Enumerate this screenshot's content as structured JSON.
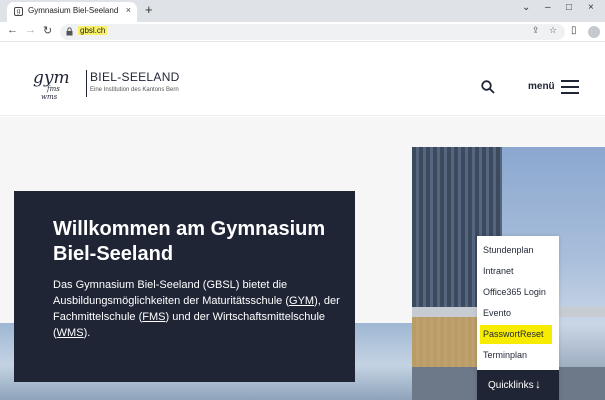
{
  "browser": {
    "tab_title": "Gymnasium Biel-Seeland",
    "tab_favicon": "gym-favicon",
    "new_tab": "+",
    "close_tab": "×",
    "url": "gbsl.ch",
    "window_controls": [
      "⌄",
      "–",
      "□",
      "×"
    ]
  },
  "header": {
    "logo": {
      "gym": "gym",
      "fms": "fms",
      "wms": "wms",
      "name": "BIEL-SEELAND",
      "subtitle": "Eine Institution des Kantons Bern"
    },
    "menu_label": "menü"
  },
  "hero": {
    "title": "Willkommen am Gymna­sium Biel-Seeland",
    "text_before": "Das Gymnasium Biel-Seeland (GBSL) bietet die Ausbildungsmöglichkeiten der Maturitätsschule (",
    "link_gym": "GYM",
    "text_mid1": "), der Fachmittelschule (",
    "link_fms": "FMS",
    "text_mid2": ") und der Wirtschaftsmittelschule (",
    "link_wms": "WMS",
    "text_after": ")."
  },
  "quicklinks": {
    "items": [
      {
        "label": "Stundenplan"
      },
      {
        "label": "Intranet"
      },
      {
        "label": "Office365 Login"
      },
      {
        "label": "Evento"
      },
      {
        "label": "PasswortReset"
      },
      {
        "label": "Terminplan"
      }
    ],
    "toggle_label": "Quicklinks",
    "highlight_color": "#f7ec00"
  },
  "colors": {
    "brand_dark": "#1f2535",
    "url_highlight": "#f9f06a"
  }
}
